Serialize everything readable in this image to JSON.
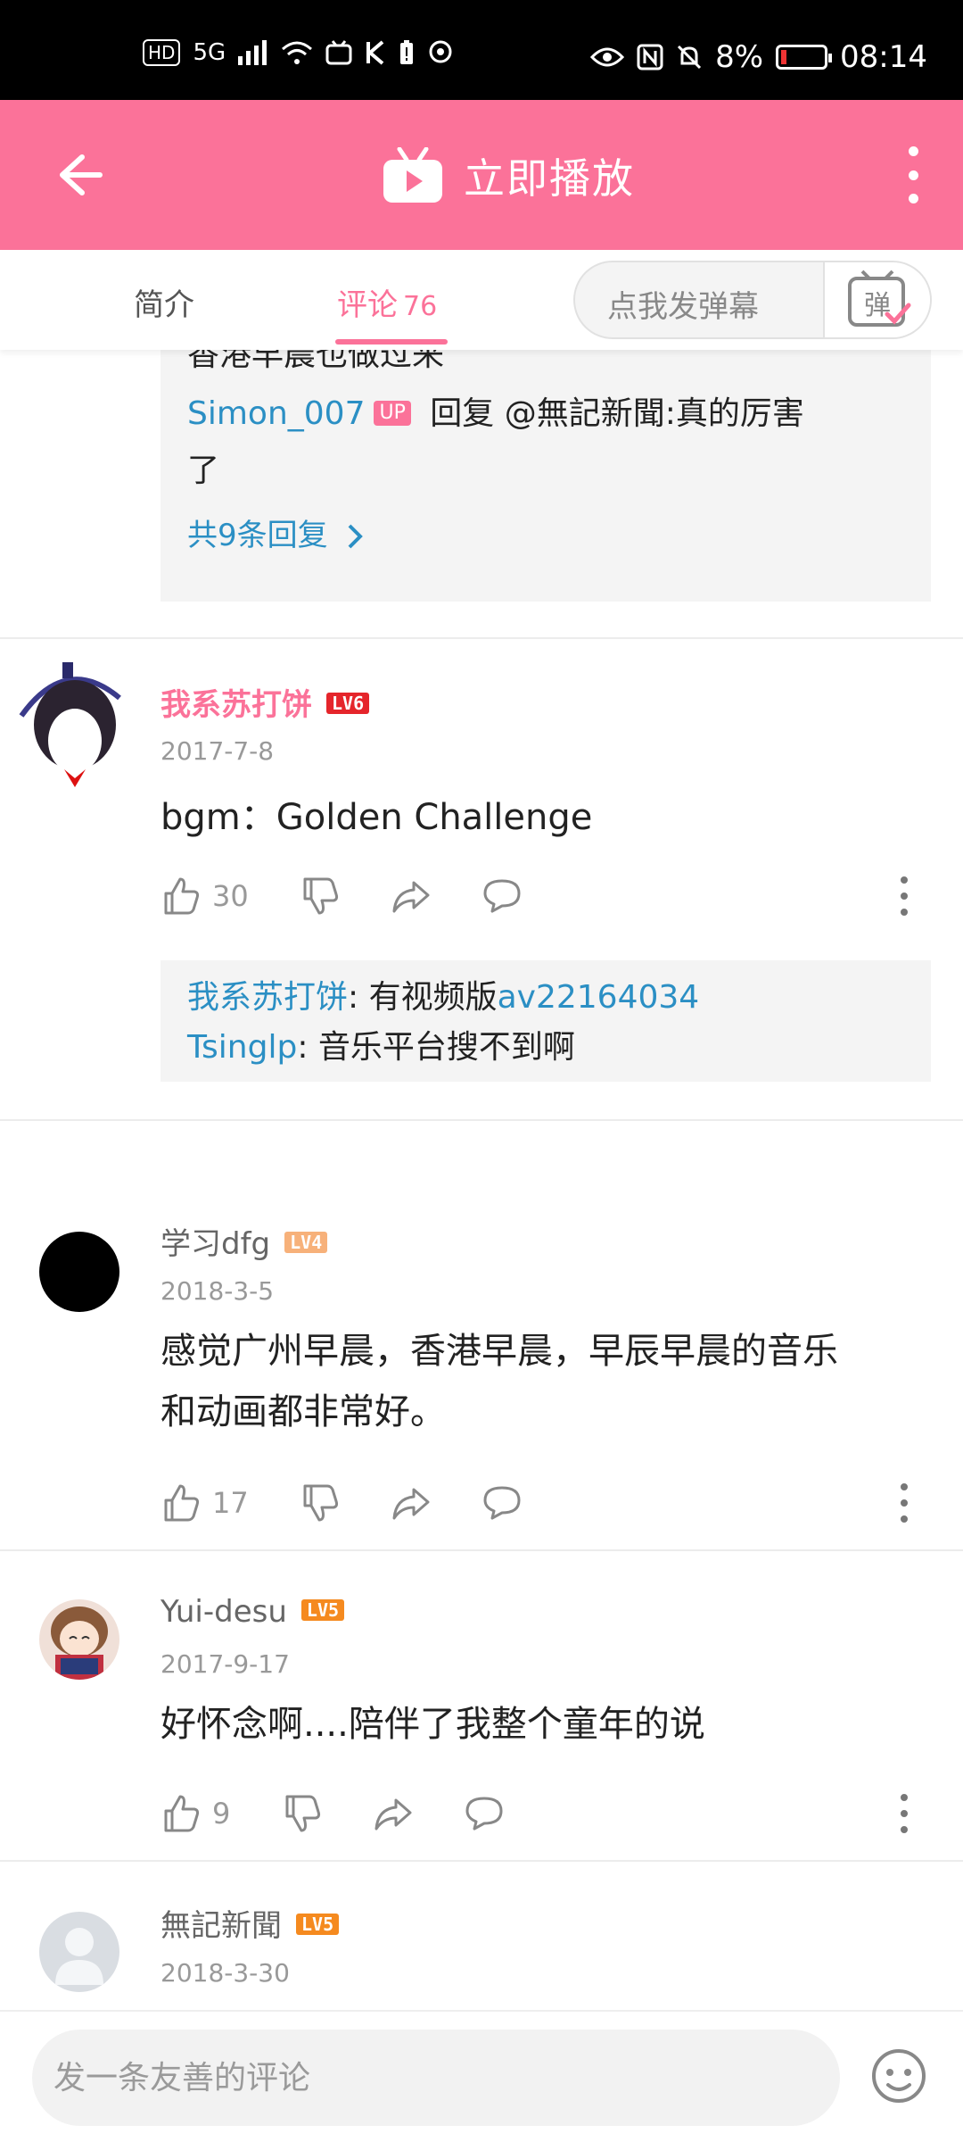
{
  "statusbar": {
    "left_icons": [
      "HD",
      "5G",
      "signal-icon",
      "wifi-icon",
      "tv-icon",
      "k-icon",
      "battery-alert-icon",
      "hotspot-icon"
    ],
    "battery": "8%",
    "time": "08:14"
  },
  "appbar": {
    "title": "立即播放"
  },
  "tabs": {
    "intro": "简介",
    "comments": "评论",
    "comments_count": "76",
    "danmaku_placeholder": "点我发弹幕",
    "danmaku_icon_label": "弹"
  },
  "thread0": {
    "partial_text": "香港早晨也做过来",
    "reply_user": "Simon_007",
    "up_badge": "UP",
    "reply_prefix": " 回复 @無記新聞:真的厉害",
    "reply_wrap": "了",
    "view_all": "共9条回复"
  },
  "comments": [
    {
      "user": "我系苏打饼",
      "level": "LV6",
      "date": "2017-7-8",
      "text": "bgm：Golden Challenge",
      "likes": "30",
      "replies": [
        {
          "user": "我系苏打饼",
          "text": ": 有视频版",
          "link": "av22164034"
        },
        {
          "user": "Tsinglp",
          "text": ": 音乐平台搜不到啊",
          "link": ""
        }
      ]
    },
    {
      "user": "学习dfg",
      "level": "LV4",
      "date": "2018-3-5",
      "text_line1": "感觉广州早晨，香港早晨，早辰早晨的音乐",
      "text_line2": "和动画都非常好。",
      "likes": "17"
    },
    {
      "user": "Yui-desu",
      "level": "LV5",
      "date": "2017-9-17",
      "text": "好怀念啊....陪伴了我整个童年的说",
      "likes": "9"
    },
    {
      "user": "無記新聞",
      "level": "LV5",
      "date": "2018-3-30"
    }
  ],
  "colors": {
    "brand_pink": "#fb7299",
    "link_blue": "#2b8fc4",
    "lv6": "#e5252b",
    "lv4": "#f7b17a",
    "lv5": "#f58a1f"
  },
  "bottom": {
    "placeholder": "发一条友善的评论"
  }
}
